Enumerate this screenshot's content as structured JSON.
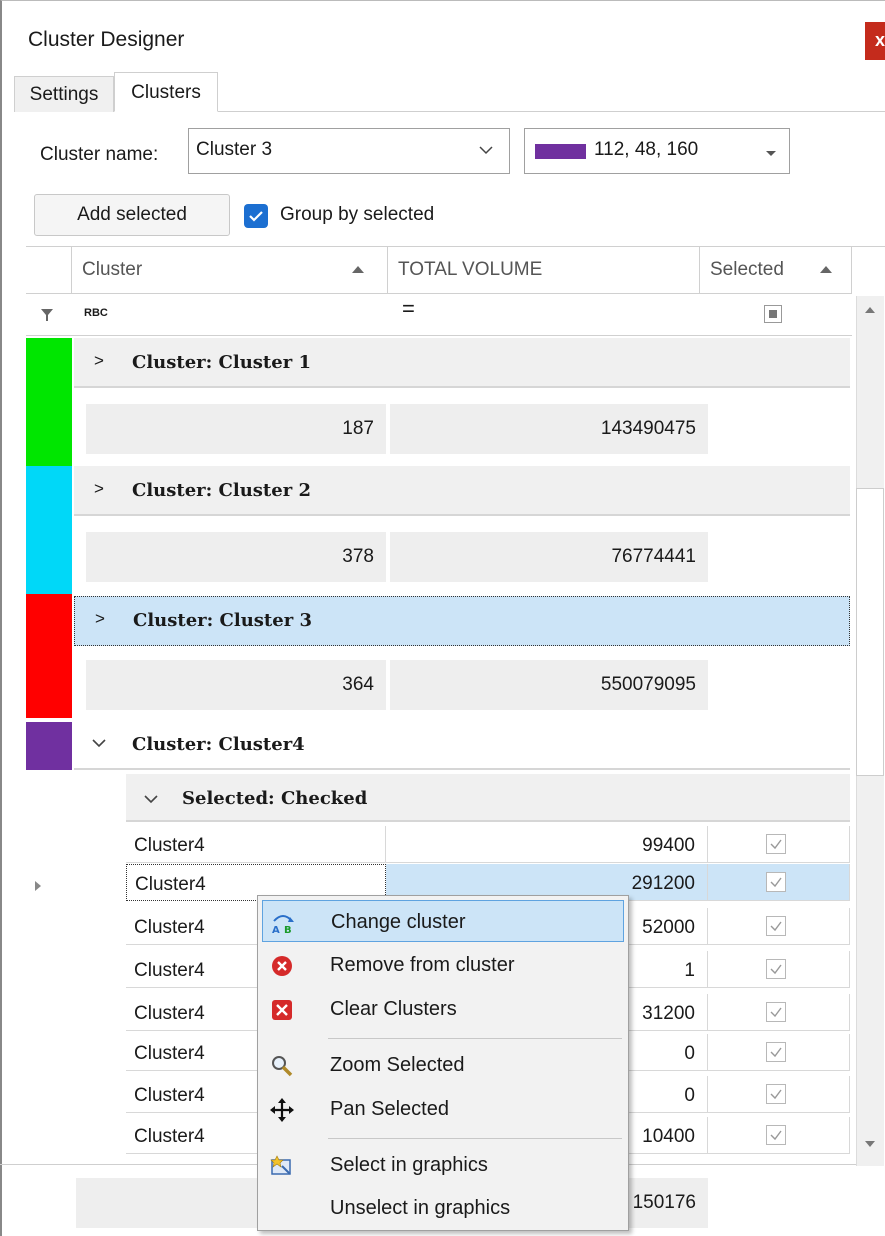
{
  "window": {
    "title": "Cluster Designer",
    "close": "x"
  },
  "tabs": [
    {
      "label": "Settings"
    },
    {
      "label": "Clusters"
    }
  ],
  "cluster_name": {
    "label": "Cluster name:",
    "value": "Cluster 3"
  },
  "color": {
    "value": "112, 48, 160",
    "swatch": "#70309f"
  },
  "toolbar": {
    "add_selected": "Add selected",
    "group_by_selected": "Group by selected",
    "group_checked": true
  },
  "columns": {
    "cluster": "Cluster",
    "total_volume": "TOTAL VOLUME",
    "selected": "Selected"
  },
  "filter": {
    "text_icon": "RBC",
    "equals": "="
  },
  "groups": [
    {
      "title": "Cluster: Cluster 1",
      "count": "187",
      "volume": "143490475",
      "color": "#00e600"
    },
    {
      "title": "Cluster: Cluster 2",
      "count": "378",
      "volume": "76774441",
      "color": "#00d8f8"
    },
    {
      "title": "Cluster: Cluster 3",
      "count": "364",
      "volume": "550079095",
      "color": "#ff0000"
    },
    {
      "title": "Cluster: Cluster4",
      "color": "#7030a0"
    }
  ],
  "subgroup": {
    "title": "Selected: Checked"
  },
  "rows": [
    {
      "cluster": "Cluster4",
      "volume": "99400"
    },
    {
      "cluster": "Cluster4",
      "volume": "291200"
    },
    {
      "cluster": "Cluster4",
      "volume": "52000"
    },
    {
      "cluster": "Cluster4",
      "volume": "1"
    },
    {
      "cluster": "Cluster4",
      "volume": "31200"
    },
    {
      "cluster": "Cluster4",
      "volume": "0"
    },
    {
      "cluster": "Cluster4",
      "volume": "0"
    },
    {
      "cluster": "Cluster4",
      "volume": "10400"
    }
  ],
  "footer": {
    "volume": "150176"
  },
  "context_menu": {
    "items": [
      {
        "label": "Change cluster",
        "icon": "change-cluster-icon"
      },
      {
        "label": "Remove from cluster",
        "icon": "remove-icon"
      },
      {
        "label": "Clear Clusters",
        "icon": "clear-icon"
      },
      {
        "label": "Zoom Selected",
        "icon": "zoom-icon"
      },
      {
        "label": "Pan Selected",
        "icon": "pan-icon"
      },
      {
        "label": "Select in graphics",
        "icon": "select-graphics-icon"
      },
      {
        "label": "Unselect in graphics",
        "icon": "unselect-graphics-icon"
      }
    ]
  }
}
